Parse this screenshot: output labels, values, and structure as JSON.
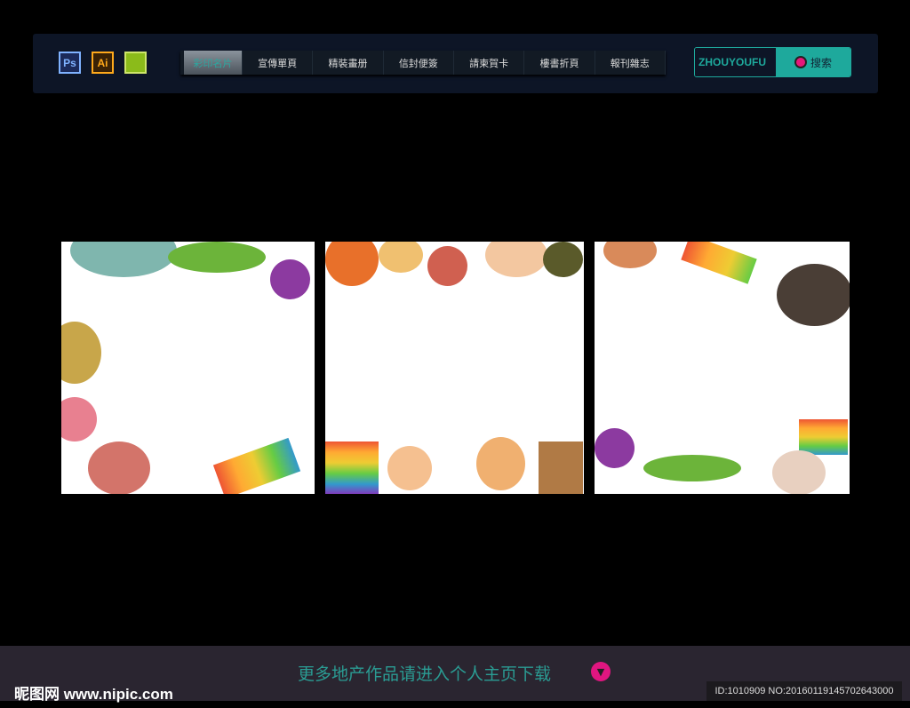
{
  "toolbar": {
    "apps": [
      "Ps",
      "Ai",
      "CorelDRAW"
    ],
    "nav": [
      "彩印名片",
      "宣傳單頁",
      "精裝畫册",
      "信封便簽",
      "請柬賀卡",
      "樓書折頁",
      "報刊雜志"
    ],
    "search_value": "ZHOUYOUFU",
    "search_label": "搜索",
    "accent": "#1ea99c"
  },
  "panels": [
    "toy-frame-1",
    "toy-frame-2",
    "toy-frame-3"
  ],
  "footer": {
    "text": "更多地产作品请进入个人主页下载",
    "logo": "昵图网 www.nipic.com",
    "id": "ID:1010909 NO:20160119145702643000"
  }
}
